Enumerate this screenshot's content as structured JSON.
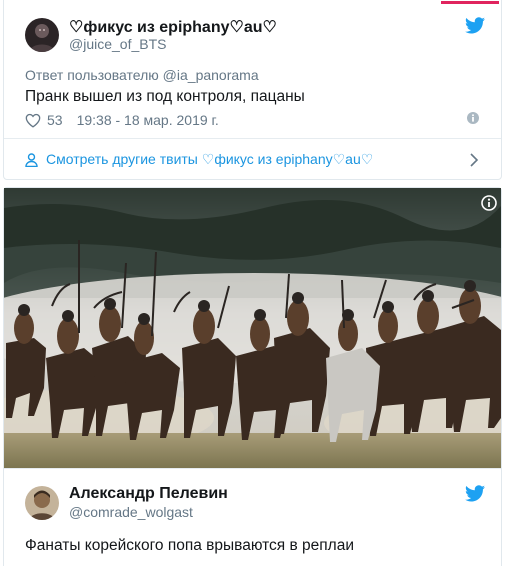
{
  "tweet1": {
    "display_name": "♡фикус из epiphany♡au♡",
    "handle": "@juice_of_BTS",
    "reply_prefix": "Ответ пользователю",
    "reply_handle": "@ia_panorama",
    "text": "Пранк вышел из под контроля, пацаны",
    "likes": "53",
    "timestamp": "19:38 - 18 мар. 2019 г.",
    "more_tweets_label": "Смотреть другие твиты ♡фикус из epiphany♡au♡"
  },
  "tweet2": {
    "display_name": "Александр Пелевин",
    "handle": "@comrade_wolgast",
    "text": "Фанаты корейского попа врываются в реплаи"
  },
  "colors": {
    "accent_red": "#e0245e",
    "twitter_blue": "#1da1f2",
    "link_blue": "#1b95e0",
    "muted_gray": "#657786",
    "text_dark": "#14171a"
  },
  "icons": [
    "twitter-bird-icon",
    "heart-icon",
    "info-icon",
    "person-icon",
    "chevron-right-icon"
  ]
}
